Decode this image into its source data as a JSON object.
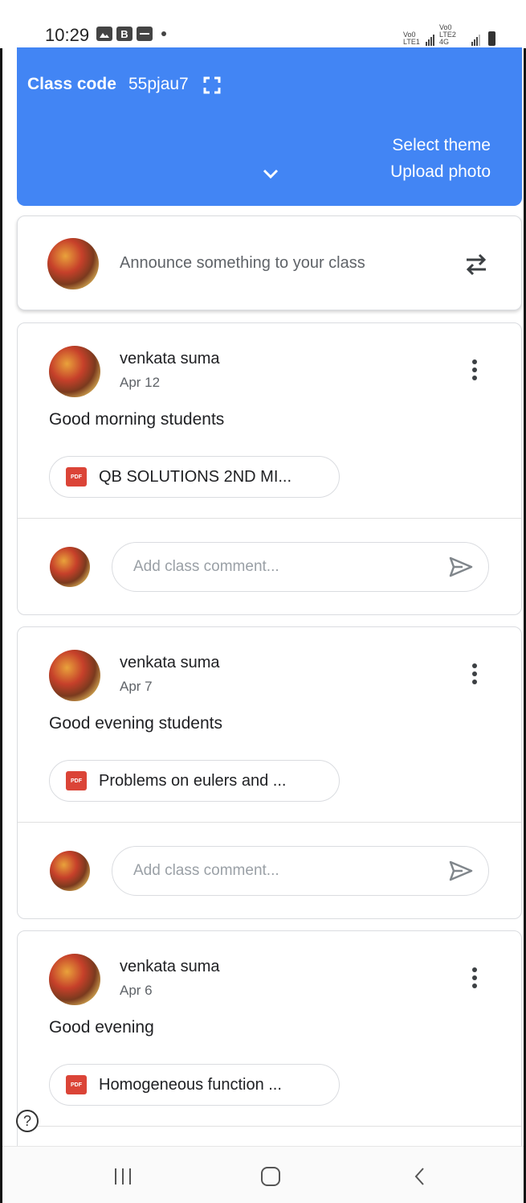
{
  "status_bar": {
    "time": "10:29",
    "icons": [
      "gallery-icon",
      "b-icon",
      "message-icon"
    ],
    "signal_label_1": "Vo0 LTE1",
    "signal_label_2": "Vo0 LTE2 4G"
  },
  "banner": {
    "color": "#4285f4",
    "class_code_label": "Class code",
    "class_code": "55pjau7",
    "select_theme": "Select theme",
    "upload_photo": "Upload photo"
  },
  "announce": {
    "placeholder": "Announce something to your class"
  },
  "posts": [
    {
      "author": "venkata suma",
      "date": "Apr 12",
      "text": "Good morning students",
      "attachment": "QB SOLUTIONS 2ND MI...",
      "comment_placeholder": "Add class comment..."
    },
    {
      "author": "venkata suma",
      "date": "Apr 7",
      "text": "Good evening students",
      "attachment": "Problems on eulers and ...",
      "comment_placeholder": "Add class comment..."
    },
    {
      "author": "venkata suma",
      "date": "Apr 6",
      "text": "Good evening",
      "attachment": "Homogeneous function ...",
      "comment_placeholder": ""
    }
  ],
  "pdf_badge": "PDF",
  "help": "?"
}
